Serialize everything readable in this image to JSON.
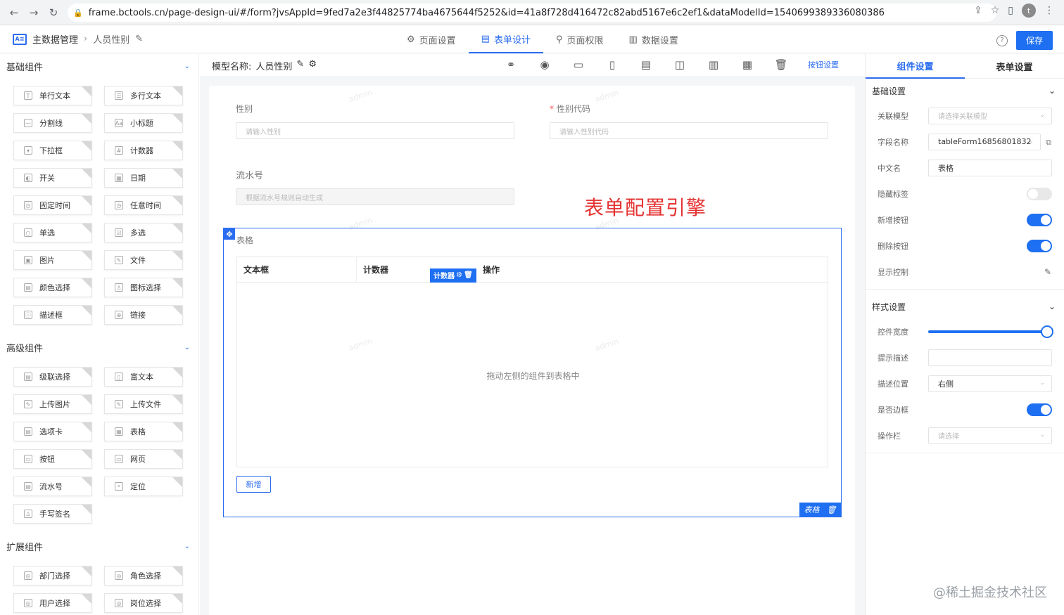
{
  "browser": {
    "url": "frame.bctools.cn/page-design-ui/#/form?jvsAppId=9fed7a2e3f44825774ba4675644f5252&id=41a8f728d416472c82abd5167e6c2ef1&dataModelId=1540699389336080386",
    "avatar": "t"
  },
  "app": {
    "brand": "主数据管理",
    "breadcrumb": "人员性别",
    "tabs": [
      "页面设置",
      "表单设计",
      "页面权限",
      "数据设置"
    ],
    "save": "保存"
  },
  "left": {
    "sections": [
      {
        "title": "基础组件",
        "items": [
          "单行文本",
          "多行文本",
          "分割线",
          "小标题",
          "下拉框",
          "计数器",
          "开关",
          "日期",
          "固定时间",
          "任意时间",
          "单选",
          "多选",
          "图片",
          "文件",
          "颜色选择",
          "图标选择",
          "描述框",
          "链接"
        ]
      },
      {
        "title": "高级组件",
        "items": [
          "级联选择",
          "富文本",
          "上传图片",
          "上传文件",
          "选项卡",
          "表格",
          "按钮",
          "网页",
          "流水号",
          "定位",
          "手写签名"
        ]
      },
      {
        "title": "扩展组件",
        "items": [
          "部门选择",
          "角色选择",
          "用户选择",
          "岗位选择"
        ]
      }
    ]
  },
  "canvas": {
    "model_label": "模型名称:",
    "model_name": "人员性别",
    "btn_settings": "按钮设置",
    "field_gender": "性别",
    "field_gender_ph": "请输入性别",
    "field_code": "性别代码",
    "field_code_ph": "请输入性别代码",
    "field_serial": "流水号",
    "field_serial_ph": "根据流水号规则自动生成",
    "engine_title": "表单配置引擎",
    "table_label": "表格",
    "col1": "文本框",
    "col2": "计数器",
    "col3": "操作",
    "chip": "计数器",
    "empty_text": "拖动左侧的组件到表格中",
    "add_btn": "新增",
    "table_badge": "表格",
    "watermark": "admin"
  },
  "right": {
    "tab_comp": "组件设置",
    "tab_form": "表单设置",
    "basic_title": "基础设置",
    "style_title": "样式设置",
    "rows": {
      "related_model": "关联模型",
      "related_model_ph": "请选择关联模型",
      "field_name": "字段名称",
      "field_name_val": "tableForm16856801832",
      "cn_name": "中文名",
      "cn_name_val": "表格",
      "hide_label": "隐藏标签",
      "add_btn": "新增按钮",
      "del_btn": "删除按钮",
      "display_ctrl": "显示控制",
      "width": "控件宽度",
      "tip": "提示描述",
      "desc_pos": "描述位置",
      "desc_pos_val": "右侧",
      "border": "是否边框",
      "op_col": "操作栏",
      "op_col_ph": "请选择"
    }
  },
  "footer_watermark": "@稀土掘金技术社区"
}
